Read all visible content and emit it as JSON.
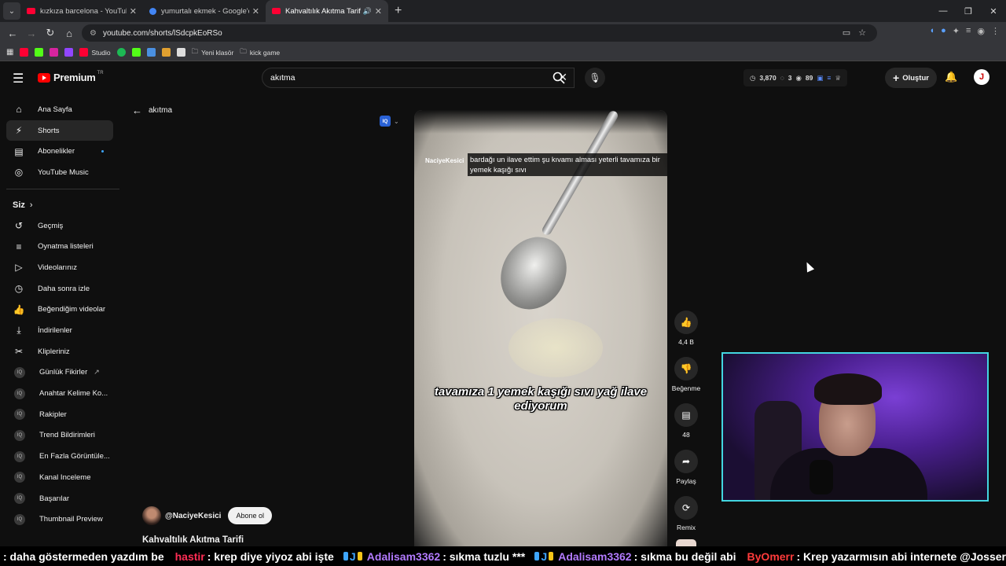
{
  "browser": {
    "tabs": [
      {
        "title": "kızkıza barcelona - YouTube",
        "favicon_color": "#ff0033"
      },
      {
        "title": "yumurtalı ekmek - Google'da Ara",
        "favicon_color": "#4285f4"
      },
      {
        "title": "Kahvaltılık Akıtma Tarifi - Yo",
        "favicon_color": "#ff0033",
        "active": true
      }
    ],
    "url": "youtube.com/shorts/lSdcpkEoRSo",
    "bookmarks": [
      "Studio",
      "Yeni klasör",
      "kick game"
    ]
  },
  "header": {
    "logo": "Premium",
    "logo_region": "TR",
    "search_value": "akıtma",
    "stats": {
      "views": "3,870",
      "a": "3",
      "b": "89"
    },
    "create_label": "Oluştur",
    "avatar_letter": "J"
  },
  "sidebar": {
    "main": [
      "Ana Sayfa",
      "Shorts",
      "Abonelikler",
      "YouTube Music"
    ],
    "you_heading": "Siz",
    "you": [
      "Geçmiş",
      "Oynatma listeleri",
      "Videolarınız",
      "Daha sonra izle",
      "Beğendiğim videolar",
      "İndirilenler",
      "Klipleriniz"
    ],
    "ext": [
      "Günlük Fikirler",
      "Anahtar Kelime Ko...",
      "Rakipler",
      "Trend Bildirimleri",
      "En Fazla Görüntüle...",
      "Kanal Inceleme",
      "Başarılar",
      "Thumbnail Preview"
    ]
  },
  "main": {
    "back_label": "akıtma",
    "video": {
      "watermark": "NaciyeKesici",
      "caption_top": "bardağı un ilave ettim şu kıvamı alması yeterli tavamıza bir yemek kaşığı sıvı",
      "caption_big": "tavamıza 1 yemek kaşığı sıvı yağ ilave ediyorum"
    },
    "actions": {
      "like": "4,4 B",
      "dislike": "Beğenme",
      "comments": "48",
      "share": "Paylaş",
      "remix": "Remix"
    },
    "channel": "@NaciyeKesici",
    "subscribe": "Abone ol",
    "title": "Kahvaltılık Akıtma Tarifi"
  },
  "ticker": {
    "t1": ": daha göstermeden yazdım be",
    "u1": "hastir",
    "t2": ": krep diye yiyoz abi işte",
    "u2": "Adalisam3362",
    "t3": ": sıkma tuzlu ***",
    "u3": "Adalisam3362",
    "t4": ": sıkma bu değil abi",
    "u4": "ByOmerr",
    "t5": ": Krep yazarmısın abi internete @Josser"
  }
}
